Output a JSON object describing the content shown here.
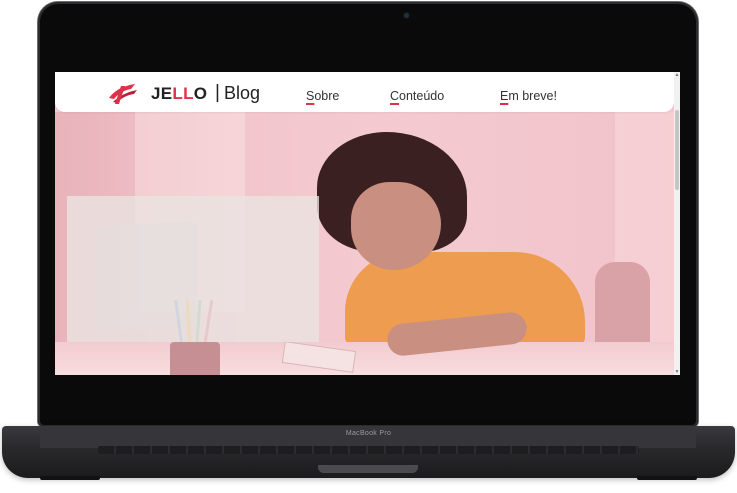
{
  "device": {
    "model_label": "MacBook Pro"
  },
  "header": {
    "logo_prefix": "JE",
    "logo_accent": "LL",
    "logo_suffix": "O",
    "separator": "|",
    "blog_label": "Blog",
    "brand_color": "#e0314a"
  },
  "nav": {
    "items": [
      {
        "first": "S",
        "rest": "obre"
      },
      {
        "first": "C",
        "rest": "onteúdo"
      },
      {
        "first": "E",
        "rest": "m breve!"
      }
    ]
  },
  "icons": {
    "logo": "jello-logo-icon",
    "scroll_up": "chevron-up-icon",
    "scroll_down": "chevron-down-icon"
  }
}
